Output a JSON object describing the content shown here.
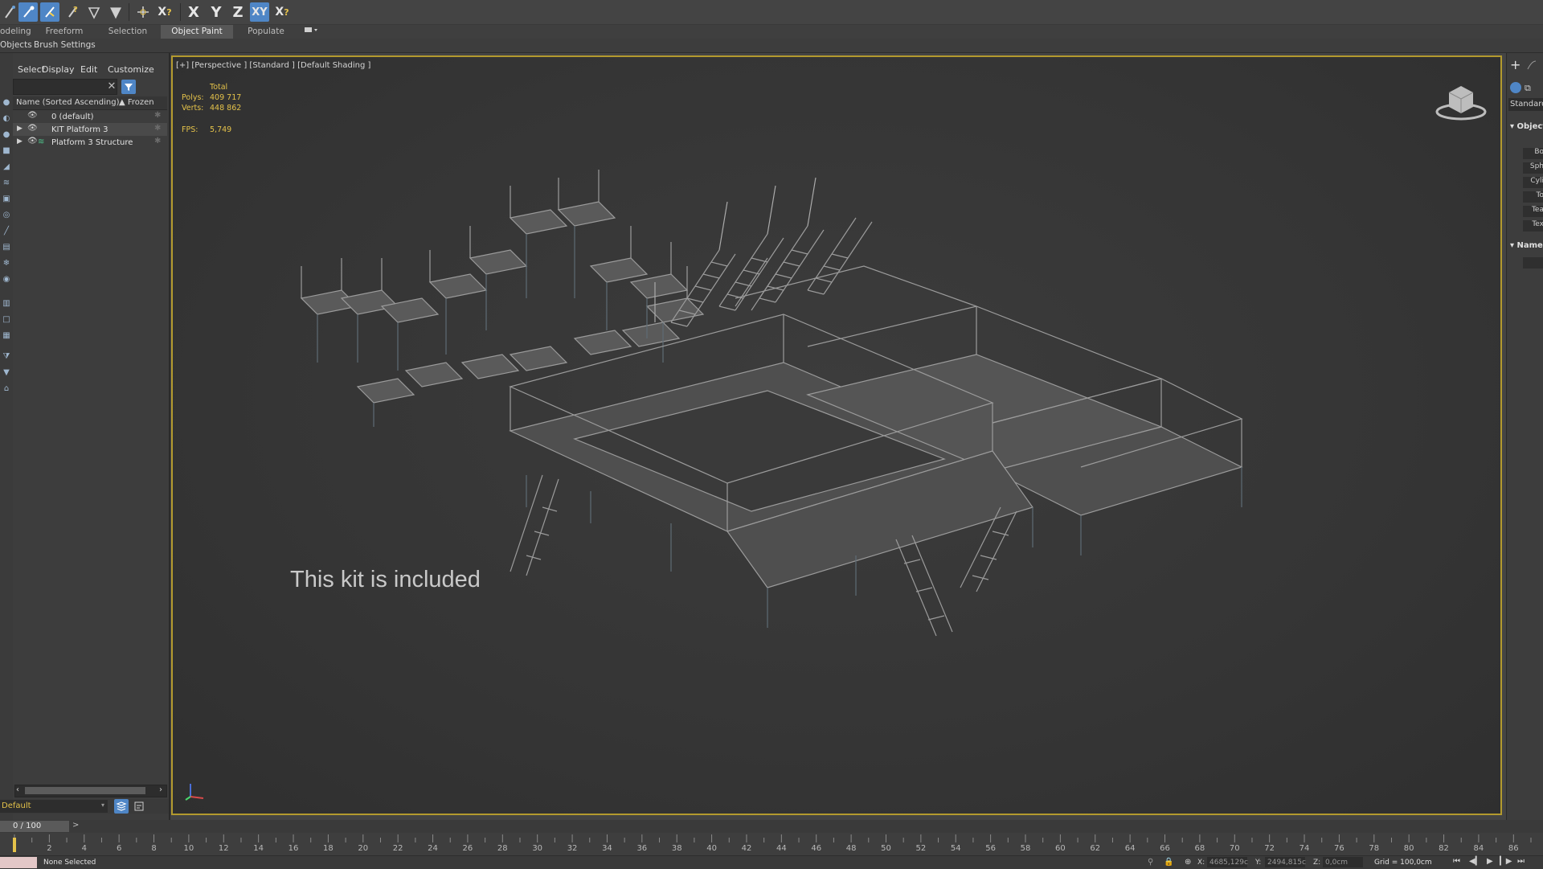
{
  "colors": {
    "accent": "#4f86c6",
    "viewport_border": "#b39a2e",
    "stats_text": "#e4c24a",
    "ui_bg": "#444444"
  },
  "toolbar": {
    "axis_x": "X",
    "axis_y": "Y",
    "axis_z": "Z",
    "axis_xy": "XY"
  },
  "ribbon": {
    "tabs": [
      "odeling",
      "Freeform",
      "Selection",
      "Object Paint",
      "Populate"
    ],
    "active_tab": "Object Paint",
    "sub_tabs": [
      "Objects",
      "Brush Settings"
    ]
  },
  "explorer": {
    "menu": [
      "Select",
      "Display",
      "Edit",
      "Customize"
    ],
    "columns": {
      "name": "Name (Sorted Ascending)",
      "frozen": "▲ Frozen"
    },
    "rows": [
      {
        "label": "0 (default)",
        "icon": "layer-icon"
      },
      {
        "label": "KIT Platform 3",
        "icon": "layer-icon"
      },
      {
        "label": "Platform 3 Structure",
        "icon": "stack-icon"
      }
    ],
    "layer_dropdown": "Default"
  },
  "viewport": {
    "label": "[+] [Perspective ] [Standard ] [Default Shading ]",
    "stats": {
      "total_label": "Total",
      "polys_label": "Polys:",
      "polys_value": "409 717",
      "verts_label": "Verts:",
      "verts_value": "448 862",
      "fps_label": "FPS:",
      "fps_value": "5,749"
    },
    "overlay_text": "This kit is included"
  },
  "right_panel": {
    "dropdown": "Standard",
    "section_object": "Object",
    "buttons": [
      "Bo",
      "Sph",
      "Cyli",
      "To",
      "Tea",
      "Tex"
    ],
    "section_name": "Name"
  },
  "timeline": {
    "frame_counter": "0 / 100",
    "ticks": [
      2,
      4,
      6,
      8,
      10,
      12,
      14,
      16,
      18,
      20,
      22,
      24,
      26,
      28,
      30,
      32,
      34,
      36,
      38,
      40,
      42,
      44,
      46,
      48,
      50,
      52,
      54,
      56,
      58,
      60,
      62,
      64,
      66,
      68,
      70,
      72,
      74,
      76,
      78,
      80,
      82,
      84,
      86
    ],
    "current_frame": 0
  },
  "status": {
    "selection": "None Selected",
    "x_label": "X:",
    "x_value": "4685,129c",
    "y_label": "Y:",
    "y_value": "2494,815c",
    "z_label": "Z:",
    "z_value": "0,0cm",
    "grid": "Grid = 100,0cm"
  }
}
